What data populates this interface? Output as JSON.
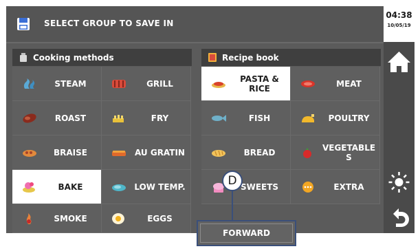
{
  "header": {
    "title": "SELECT GROUP TO SAVE IN",
    "time": "04:38",
    "date": "10/05/19"
  },
  "cooking_methods": {
    "title": "Cooking methods",
    "items": [
      {
        "label": "STEAM",
        "icon": "steam-icon"
      },
      {
        "label": "GRILL",
        "icon": "grill-icon"
      },
      {
        "label": "ROAST",
        "icon": "roast-icon"
      },
      {
        "label": "FRY",
        "icon": "fry-icon"
      },
      {
        "label": "BRAISE",
        "icon": "braise-icon"
      },
      {
        "label": "AU GRATIN",
        "icon": "au-gratin-icon"
      },
      {
        "label": "BAKE",
        "icon": "bake-icon",
        "selected": true
      },
      {
        "label": "LOW TEMP.",
        "icon": "low-temp-icon"
      },
      {
        "label": "SMOKE",
        "icon": "smoke-icon"
      },
      {
        "label": "EGGS",
        "icon": "eggs-icon"
      }
    ]
  },
  "recipe_book": {
    "title": "Recipe book",
    "items": [
      {
        "label": "PASTA &\nRICE",
        "icon": "pasta-rice-icon",
        "selected": true
      },
      {
        "label": "MEAT",
        "icon": "meat-icon"
      },
      {
        "label": "FISH",
        "icon": "fish-icon"
      },
      {
        "label": "POULTRY",
        "icon": "poultry-icon"
      },
      {
        "label": "BREAD",
        "icon": "bread-icon"
      },
      {
        "label": "VEGETABLE\nS",
        "icon": "vegetables-icon"
      },
      {
        "label": "SWEETS",
        "icon": "sweets-icon"
      },
      {
        "label": "EXTRA",
        "icon": "extra-icon"
      }
    ]
  },
  "forward_button": {
    "label": "FORWARD"
  },
  "callout": {
    "label": "D"
  },
  "right_bar": {
    "buttons": [
      "home-icon",
      "brightness-icon",
      "back-icon"
    ]
  },
  "colors": {
    "selected_bg": "#ffffff",
    "cell_bg": "#5f5f5f",
    "callout": "#3a4f7a"
  }
}
